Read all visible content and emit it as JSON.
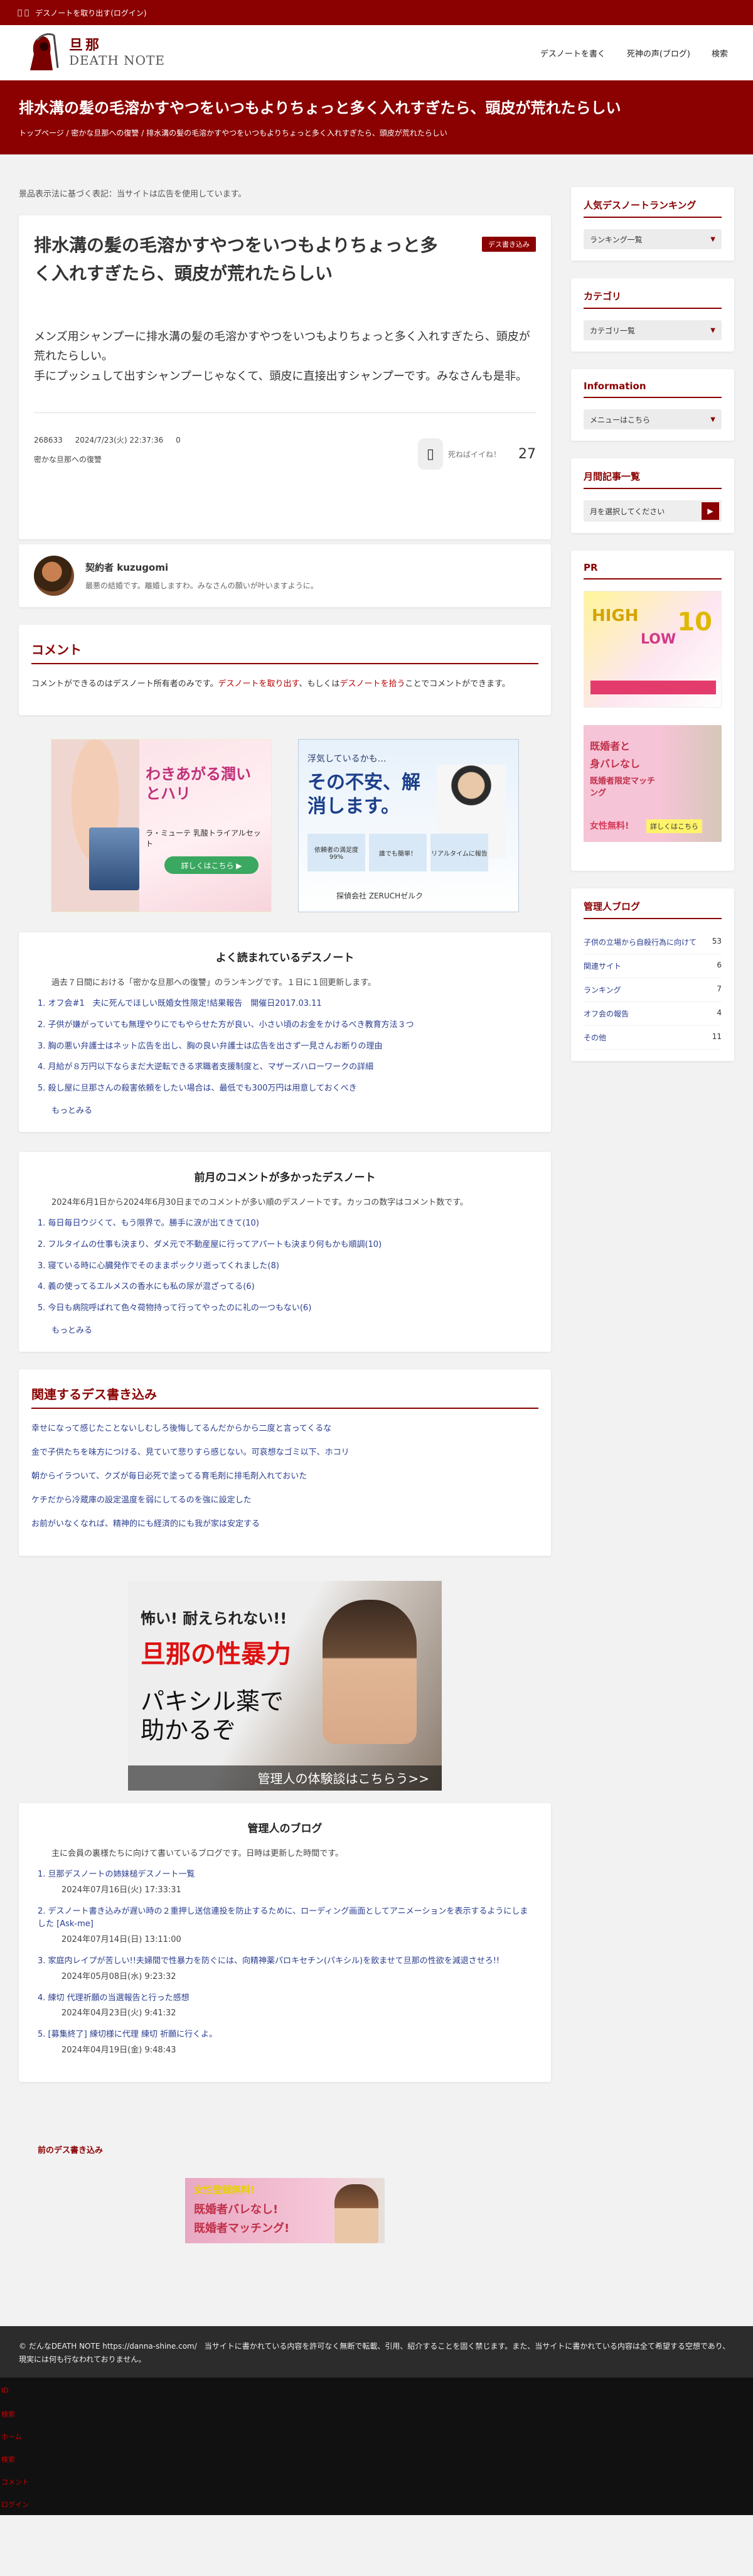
{
  "topbar": {
    "icons": " ",
    "login_text": "デスノートを取り出す(ログイン)"
  },
  "header": {
    "logo_jp": "旦那",
    "logo_en": "DEATH NOTE",
    "nav": [
      "デスノートを書く",
      "死神の声(ブログ)",
      "検索"
    ]
  },
  "hero": {
    "title": "排水溝の髪の毛溶かすやつをいつもよりちょっと多く入れすぎたら、頭皮が荒れたらしい",
    "breadcrumb": "トップページ / 密かな旦那への復讐 / 排水溝の髪の毛溶かすやつをいつもよりちょっと多く入れすぎたら、頭皮が荒れたらしい"
  },
  "notice": "景品表示法に基づく表記：当サイトは広告を使用しています。",
  "article": {
    "title": "排水溝の髪の毛溶かすやつをいつもよりちょっと多く入れすぎたら、頭皮が荒れたらしい",
    "badge": "デス書き込み",
    "body": [
      "メンズ用シャンプーに排水溝の髪の毛溶かすやつをいつもよりちょっと多く入れすぎたら、頭皮が荒れたらしい。",
      "手にプッシュして出すシャンプーじゃなくて、頭皮に直接出すシャンプーです。みなさんも是非。"
    ],
    "id": "268633",
    "datetime": "2024/7/23(火) 22:37:36",
    "comment_count": "0",
    "category": "密かな旦那への復讐",
    "like_label": "死ねばイイね！",
    "like_count": "27"
  },
  "author": {
    "name": "契約者 kuzugomi",
    "desc": "最悪の結婚です。離婚しますわ。みなさんの願いが叶いますように。"
  },
  "comments": {
    "title": "コメント",
    "text_a": "コメントができるのはデスノート所有者のみです。",
    "link_a": "デスノートを取り出す",
    "text_b": "、もしくは",
    "link_b": "デスノートを拾う",
    "text_c": "ことでコメントができます。"
  },
  "ads": {
    "ad1_title": "わきあがる潤いとハリ",
    "ad1_sub": "ラ・ミューテ 乳酸トライアルセット",
    "ad1_cta": "詳しくはこちら ▶",
    "ad2_head": "浮気しているかも…",
    "ad2_title": "その不安、解消します。",
    "ad2_c1": "依頼者の満足度99%",
    "ad2_c2": "誰でも簡単！",
    "ad2_c3": "リアルタイムに報告",
    "ad2_company": "探偵会社 ZERUCHゼルク"
  },
  "weekly_ranking": {
    "title": "よく読まれているデスノート",
    "desc": "過去７日間における「密かな旦那への復讐」のランキングです。１日に１回更新します。",
    "items": [
      "オフ会#1　夫に死んでほしい既婚女性限定!結果報告　開催日2017.03.11",
      "子供が嫌がっていても無理やりにでもやらせた方が良い、小さい頃のお金をかけるべき教育方法３つ",
      "胸の悪い弁護士はネット広告を出し、胸の良い弁護士は広告を出さず一見さんお断りの理由",
      "月給が８万円以下ならまだ大逆転できる求職者支援制度と、マザーズハローワークの詳細",
      "殺し屋に旦那さんの殺害依頼をしたい場合は、最低でも300万円は用意しておくべき"
    ],
    "more": "もっとみる"
  },
  "monthly_ranking": {
    "title": "前月のコメントが多かったデスノート",
    "desc": "2024年6月1日から2024年6月30日までのコメントが多い順のデスノートです。カッコの数字はコメント数です。",
    "items": [
      "毎日毎日ウジくて、もう限界で。勝手に涙が出てきて(10)",
      "フルタイムの仕事も決まり、ダメ元で不動産屋に行ってアパートも決まり何もかも順調(10)",
      "寝ている時に心臓発作でそのままポックリ逝ってくれました(8)",
      "義の使ってるエルメスの香水にも私の尿が混ざってる(6)",
      "今日も病院呼ばれて色々荷物持って行ってやったのに礼の一つもない(6)"
    ],
    "more": "もっとみる"
  },
  "related": {
    "title": "関連するデス書き込み",
    "items": [
      "幸せになって感じたことないしむしろ後悔してるんだからから二度と言ってくるな",
      "金で子供たちを味方につける、見ていて悲りすら感じない。可哀想なゴミ以下、ホコリ",
      "朝からイラついて、クズが毎日必死で塗ってる育毛剤に排毛剤入れておいた",
      "ケチだから冷蔵庫の設定温度を弱にしてるのを強に設定した",
      "お前がいなくなれば、精神的にも経済的にも我が家は安定する"
    ]
  },
  "big_ad": {
    "line1": "怖い! 耐えられない!!",
    "line2": "旦那の性暴力",
    "line3": "パキシル薬で助かるぞ",
    "cta": "管理人の体験談はこちらう>>"
  },
  "admin_blog": {
    "title": "管理人のブログ",
    "desc": "主に会員の裏様たちに向けて書いているブログです。日時は更新した時間です。",
    "items": [
      {
        "title": "旦那デスノートの姉妹槌デスノート一覧",
        "date": "2024年07月16日(火) 17:33:31"
      },
      {
        "title": "デスノート書き込みが遅い時の２重押し送信連投を防止するために、ローディング画面としてアニメーションを表示するようにしました [Ask-me]",
        "date": "2024年07月14日(日) 13:11:00"
      },
      {
        "title": "家庭内レイプが苦しい!!夫婦間で性暴力を防ぐには、向精神薬パロキセチン(パキシル)を飲ませて旦那の性欲を減退させろ!!",
        "date": "2024年05月08日(水) 9:23:32"
      },
      {
        "title": "練切 代理祈願の当選報告と行った感想",
        "date": "2024年04月23日(火) 9:41:32"
      },
      {
        "title": "[募集終了] 練切様に代理 練切 祈願に行くよ。",
        "date": "2024年04月19日(金) 9:48:43"
      }
    ]
  },
  "prev_link": "前のデス書き込み",
  "bottom_ad": {
    "line1": "女性登録無料!",
    "line2": "既婚者バレなし!",
    "line3": "既婚者マッチング!"
  },
  "footer": {
    "text": "© だんなDEATH NOTE https://danna-shine.com/　当サイトに書かれている内容を許可なく無断で転載、引用、紹介することを固く禁じます。また、当サイトに書かれている内容は全て希望する空想であり、現実には何も行なわれておりません。"
  },
  "footer_links": [
    "ID",
    "検索",
    "ホーム",
    "検索",
    "コメント",
    "ログイン"
  ],
  "sidebar": {
    "popular": {
      "title": "人気デスノートランキング",
      "select": "ランキング一覧"
    },
    "category": {
      "title": "カテゴリ",
      "select": "カテゴリ一覧"
    },
    "info": {
      "title": "Information",
      "select": "メニューはこちら"
    },
    "monthly": {
      "title": "月間記事一覧",
      "select": "月を選択してください",
      "go": "▶"
    },
    "pr": {
      "title": "PR",
      "pr1_a": "HIGH",
      "pr1_b": "LOW",
      "pr1_c": "10",
      "pr2_a": "既婚者と",
      "pr2_b": "身バレなし",
      "pr2_c": "既婚者限定マッチング",
      "pr2_d": "女性無料!",
      "pr2_e": "詳しくはこちら"
    },
    "admin": {
      "title": "管理人ブログ",
      "rows": [
        {
          "label": "子供の立場から自殺行為に向けて",
          "count": "53"
        },
        {
          "label": "関連サイト",
          "count": "6"
        },
        {
          "label": "ランキング",
          "count": "7"
        },
        {
          "label": "オフ会の報告",
          "count": "4"
        },
        {
          "label": "その他",
          "count": "11"
        }
      ]
    }
  }
}
